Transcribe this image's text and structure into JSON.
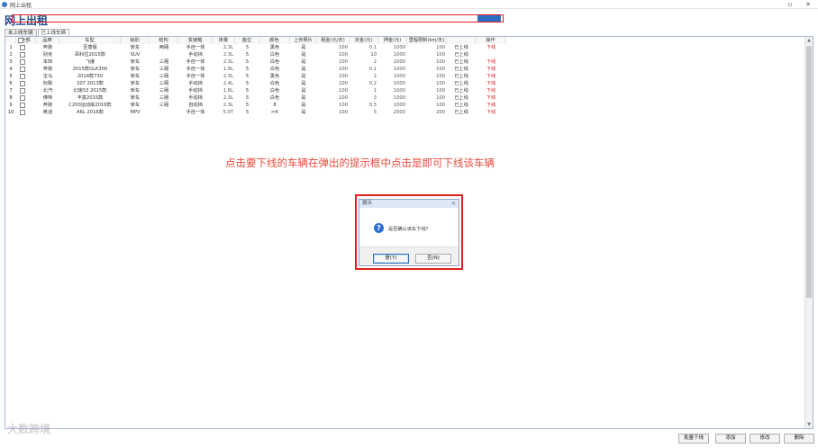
{
  "window": {
    "title": "网上出租",
    "controls": [
      "▫",
      "✕"
    ]
  },
  "page_title": "网上出租",
  "tabs": [
    {
      "label": "未上线车辆",
      "active": false
    },
    {
      "label": "已上线车辆",
      "active": true
    }
  ],
  "table": {
    "columns": [
      "",
      "全部",
      "品牌",
      "车型",
      "级别",
      "结构",
      "变速箱",
      "排量",
      "座位",
      "颜色",
      "上传照片",
      "租金(元/天)",
      "定金(元)",
      "押金(元)",
      "里程限制(km/天)",
      "",
      "操作"
    ],
    "rows": [
      [
        "1",
        "",
        "奔驰",
        "至尊版",
        "轿车",
        "两厢",
        "手自一体",
        "2.3L",
        "5",
        "黑色",
        "是",
        "100",
        "0.1",
        "1000",
        "100",
        "已上线",
        "下线"
      ],
      [
        "2",
        "",
        "别克",
        "昂科拉2015款",
        "SUV",
        "",
        "手动挡",
        "2.3L",
        "5",
        "白色",
        "是",
        "100",
        "10",
        "1000",
        "100",
        "已上线",
        ""
      ],
      [
        "3",
        "",
        "本田",
        "飞度",
        "轿车",
        "三厢",
        "手自一体",
        "2.3L",
        "5",
        "白色",
        "是",
        "100",
        "2",
        "1000",
        "100",
        "已上线",
        "下线"
      ],
      [
        "4",
        "",
        "奔驰",
        "2015款GLK300",
        "轿车",
        "三厢",
        "手自一体",
        "1.9L",
        "5",
        "白色",
        "是",
        "100",
        "0.1",
        "1000",
        "100",
        "已上线",
        "下线"
      ],
      [
        "5",
        "",
        "宝马",
        "2014款730",
        "轿车",
        "三厢",
        "手自一体",
        "2.3L",
        "5",
        "黑色",
        "是",
        "100",
        "2",
        "1000",
        "100",
        "已上线",
        "下线"
      ],
      [
        "6",
        "",
        "标致",
        "207 2013款",
        "轿车",
        "三厢",
        "手动挡",
        "2.4L",
        "5",
        "白色",
        "是",
        "100",
        "0.2",
        "1000",
        "100",
        "已上线",
        "下线"
      ],
      [
        "7",
        "",
        "北汽",
        "幻速S3 2015款",
        "轿车",
        "三厢",
        "手动挡",
        "1.6L",
        "5",
        "白色",
        "是",
        "100",
        "1",
        "1000",
        "100",
        "已上线",
        "下线"
      ],
      [
        "8",
        "",
        "佛特",
        "丰富2015款",
        "轿车",
        "三厢",
        "手动挡",
        "2.3L",
        "5",
        "白色",
        "是",
        "100",
        "3",
        "1000",
        "100",
        "已上线",
        "下线"
      ],
      [
        "9",
        "",
        "奔驰",
        "C200运动版2016款",
        "轿车",
        "三厢",
        "自动挡",
        "2.3L",
        "5",
        "8",
        "是",
        "100",
        "0.5",
        "1000",
        "100",
        "已上线",
        "下线"
      ],
      [
        "10",
        "",
        "奥迪",
        "A6L 2016款",
        "MPV",
        "",
        "手自一体",
        "5.0T",
        "5",
        "rr4",
        "是",
        "100",
        "5",
        "2000",
        "200",
        "已上线",
        "下线"
      ]
    ]
  },
  "annotation": "点击要下线的车辆在弹出的提示框中点击是即可下线该车辆",
  "dialog": {
    "title": "提示",
    "message": "是否确认该车下线?",
    "yes_label": "是(Y)",
    "no_label": "否(N)"
  },
  "bottom_buttons": {
    "batch_offline": "批量下线",
    "add": "添加",
    "edit": "修改",
    "delete": "删除"
  },
  "watermark": "大数跨境",
  "colors": {
    "title_blue": "#1f4e8c",
    "annotation_red": "#e84b3c",
    "highlight_red": "#e02020",
    "select_blue": "#2b6fc2"
  }
}
